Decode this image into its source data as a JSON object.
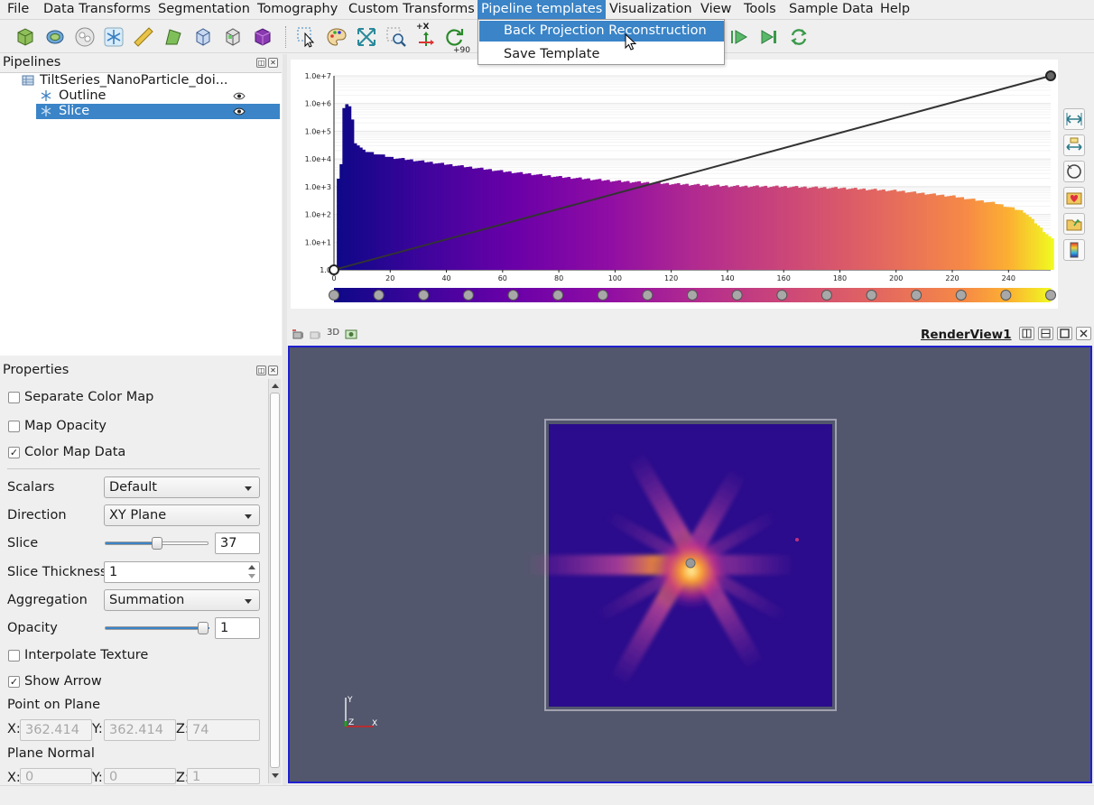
{
  "menubar": {
    "items": [
      "File",
      "Data Transforms",
      "Segmentation",
      "Tomography",
      "Custom Transforms",
      "Pipeline templates",
      "Visualization",
      "View",
      "Tools",
      "Sample Data",
      "Help"
    ],
    "active": "Pipeline templates"
  },
  "dropdown": {
    "items": [
      "Back Projection Reconstruction",
      "Save Template"
    ],
    "highlighted": "Back Projection Reconstruction"
  },
  "toolbar": {
    "rotate_label": "+90",
    "axis_label": "+X"
  },
  "pipelines": {
    "title": "Pipelines",
    "root": "TiltSeries_NanoParticle_doi...",
    "children": [
      {
        "label": "Outline",
        "selected": false
      },
      {
        "label": "Slice",
        "selected": true
      }
    ]
  },
  "properties": {
    "title": "Properties",
    "separate_color_map": {
      "label": "Separate Color Map",
      "checked": false
    },
    "map_opacity": {
      "label": "Map Opacity",
      "checked": false
    },
    "color_map_data": {
      "label": "Color Map Data",
      "checked": true
    },
    "scalars": {
      "label": "Scalars",
      "value": "Default"
    },
    "direction": {
      "label": "Direction",
      "value": "XY Plane"
    },
    "slice": {
      "label": "Slice",
      "value": "37",
      "fraction": 0.5
    },
    "slice_thickness": {
      "label": "Slice Thickness",
      "value": "1"
    },
    "aggregation": {
      "label": "Aggregation",
      "value": "Summation"
    },
    "opacity": {
      "label": "Opacity",
      "value": "1",
      "fraction": 1.0
    },
    "interpolate_texture": {
      "label": "Interpolate Texture",
      "checked": false
    },
    "show_arrow": {
      "label": "Show Arrow",
      "checked": true
    },
    "point_on_plane": {
      "label": "Point on Plane",
      "x_label": "X:",
      "y_label": "Y:",
      "z_label": "Z:",
      "x": "362.414",
      "y": "362.414",
      "z": "74"
    },
    "plane_normal": {
      "label": "Plane Normal",
      "x_label": "X:",
      "y_label": "Y:",
      "z_label": "Z:",
      "x": "0",
      "y": "0",
      "z": "1"
    }
  },
  "render_view": {
    "title": "RenderView1",
    "mode_label": "3D",
    "axis_x": "X",
    "axis_y": "Y",
    "axis_z": "Z",
    "background": "#52576d",
    "volume_color": "#2a0c8c"
  },
  "chart_data": {
    "type": "bar",
    "title": "",
    "xlabel": "",
    "ylabel": "",
    "yscale": "log",
    "xlim": [
      0,
      255
    ],
    "ylim": [
      1,
      10000000
    ],
    "x_ticks": [
      "0",
      "20",
      "40",
      "60",
      "80",
      "100",
      "120",
      "140",
      "160",
      "180",
      "200",
      "220",
      "240"
    ],
    "y_ticks": [
      "1.0",
      "1.0e+1",
      "1.0e+2",
      "1.0e+3",
      "1.0e+4",
      "1.0e+5",
      "1.0e+6",
      "1.0e+7"
    ],
    "colormap": "plasma",
    "opacity_line": [
      [
        0,
        1
      ],
      [
        255,
        10000000
      ]
    ],
    "histogram_profile_log10": [
      [
        0,
        0
      ],
      [
        1,
        3.3
      ],
      [
        2,
        3.8
      ],
      [
        3,
        5.8
      ],
      [
        4,
        6.0
      ],
      [
        5,
        5.9
      ],
      [
        6,
        5.4
      ],
      [
        7,
        4.6
      ],
      [
        10,
        4.3
      ],
      [
        20,
        4.05
      ],
      [
        40,
        3.8
      ],
      [
        60,
        3.55
      ],
      [
        80,
        3.35
      ],
      [
        100,
        3.2
      ],
      [
        120,
        3.1
      ],
      [
        140,
        3.02
      ],
      [
        160,
        3.0
      ],
      [
        180,
        2.95
      ],
      [
        200,
        2.85
      ],
      [
        220,
        2.65
      ],
      [
        235,
        2.4
      ],
      [
        245,
        2.1
      ],
      [
        250,
        1.6
      ],
      [
        255,
        1.1
      ]
    ]
  }
}
